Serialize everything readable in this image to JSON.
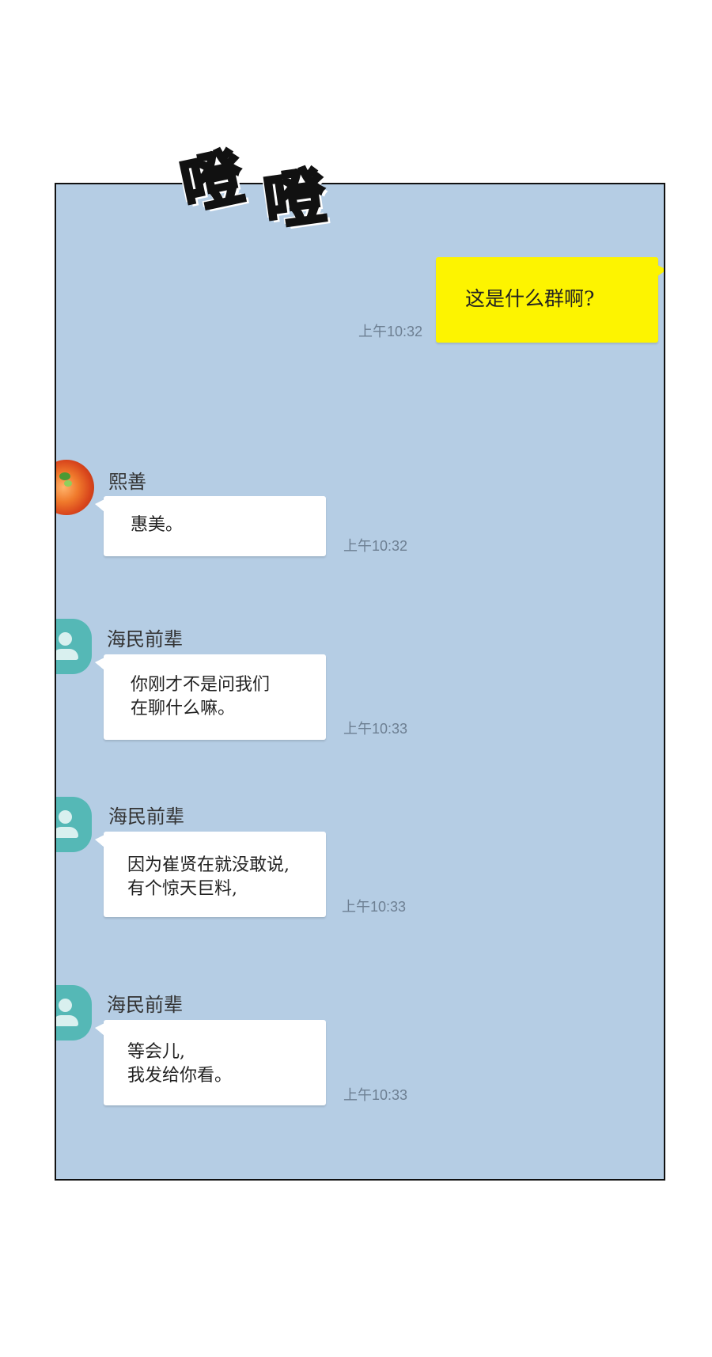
{
  "sfx": {
    "text_1": "噔",
    "text_2": "噔"
  },
  "messages": [
    {
      "sender": "",
      "text": "这是什么群啊?",
      "time": "上午10:32",
      "mine": true
    },
    {
      "sender": "熙善",
      "text": "惠美。",
      "time": "上午10:32",
      "avatar": "food-photo"
    },
    {
      "sender": "海民前辈",
      "text": "你刚才不是问我们\n在聊什么嘛。",
      "time": "上午10:33",
      "avatar": "person-icon"
    },
    {
      "sender": "海民前辈",
      "text": "因为崔贤在就没敢说,\n有个惊天巨料,",
      "time": "上午10:33",
      "avatar": "person-icon"
    },
    {
      "sender": "海民前辈",
      "text": "等会儿,\n我发给你看。",
      "time": "上午10:33",
      "avatar": "person-icon"
    }
  ],
  "colors": {
    "chat_background": "#b5cde4",
    "my_bubble": "#fdf400",
    "their_bubble": "#ffffff",
    "default_avatar": "#55b8b6"
  }
}
